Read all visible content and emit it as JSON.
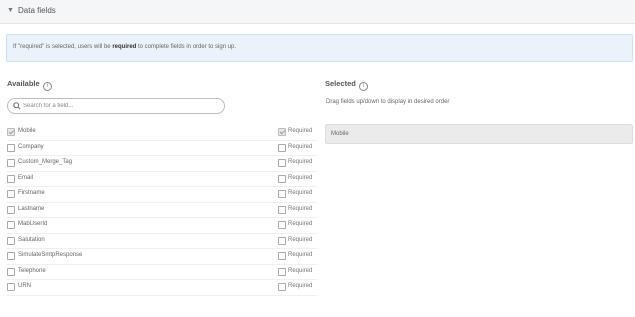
{
  "section": {
    "title": "Data fields"
  },
  "info": {
    "before": "If \"required\" is selected, users will be ",
    "bold": "required",
    "after": " to complete fields in order to sign up."
  },
  "available": {
    "title": "Available",
    "info_glyph": "i",
    "search_placeholder": "Search for a field...",
    "required_label": "Required",
    "fields": [
      {
        "name": "Mobile",
        "checked": true,
        "required": true
      },
      {
        "name": "Company",
        "checked": false,
        "required": false
      },
      {
        "name": "Custom_Merge_Tag",
        "checked": false,
        "required": false
      },
      {
        "name": "Email",
        "checked": false,
        "required": false
      },
      {
        "name": "Firstname",
        "checked": false,
        "required": false
      },
      {
        "name": "Lastname",
        "checked": false,
        "required": false
      },
      {
        "name": "MabUserId",
        "checked": false,
        "required": false
      },
      {
        "name": "Salutation",
        "checked": false,
        "required": false
      },
      {
        "name": "SimulateSmtpResponse",
        "checked": false,
        "required": false
      },
      {
        "name": "Telephone",
        "checked": false,
        "required": false
      },
      {
        "name": "URN",
        "checked": false,
        "required": false
      }
    ]
  },
  "selected": {
    "title": "Selected",
    "info_glyph": "i",
    "hint": "Drag fields up/down to display in desired order",
    "items": [
      "Mobile"
    ]
  },
  "icons": {
    "caret": "caret-down-icon",
    "search": "search-icon",
    "info": "info-icon",
    "checkbox": "checkbox-icon"
  }
}
